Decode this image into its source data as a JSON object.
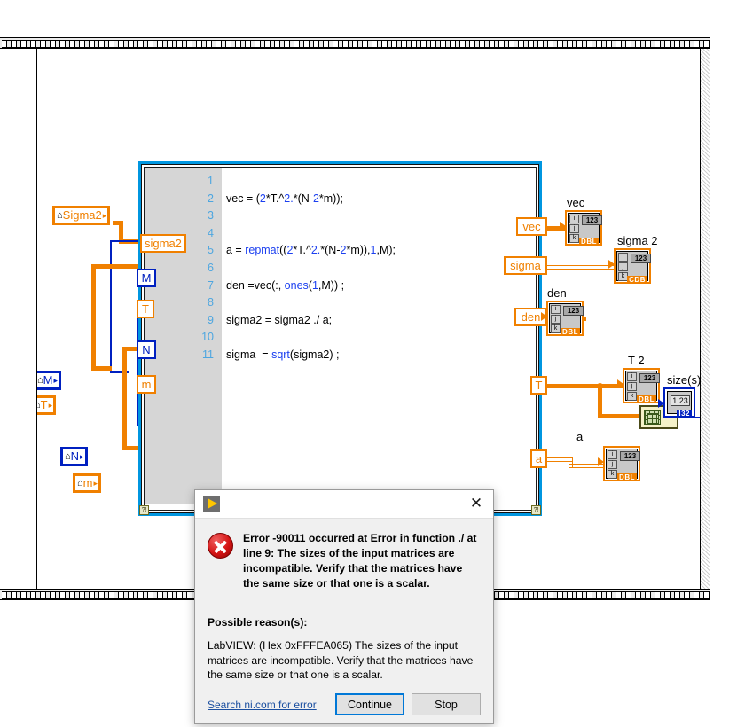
{
  "window": {
    "type": "labview-block-diagram"
  },
  "mathscript": {
    "line_numbers": [
      "1",
      "2",
      "3",
      "4",
      "5",
      "6",
      "7",
      "8",
      "9",
      "10",
      "11"
    ],
    "code_lines": [
      "",
      "vec = (2*T.^2.*(N-2*m));",
      "",
      "",
      "a = repmat((2*T.^2.*(N-2*m)),1,M);",
      "",
      "den =vec(:, ones(1,M)) ;",
      "",
      "sigma2 = sigma2 ./ a;",
      "",
      "sigma  = sqrt(sigma2) ;"
    ],
    "input_terminals": [
      {
        "label": "sigma2",
        "color": "#f08000"
      },
      {
        "label": "M",
        "color": "#0020c0"
      },
      {
        "label": "T",
        "color": "#f08000"
      },
      {
        "label": "N",
        "color": "#0020c0"
      },
      {
        "label": "m",
        "color": "#f08000"
      }
    ],
    "output_terminals": [
      {
        "label": "vec",
        "color": "#f08000"
      },
      {
        "label": "sigma",
        "color": "#f08000"
      },
      {
        "label": "den",
        "color": "#f08000"
      },
      {
        "label": "T",
        "color": "#f08000"
      },
      {
        "label": "a",
        "color": "#f08000"
      }
    ],
    "error_terminal_glyph": "?!"
  },
  "controls": [
    {
      "name": "Sigma2",
      "glyph": "⌂",
      "arrow": "▸",
      "color": "#f08000"
    },
    {
      "name": "M",
      "glyph": "⌂",
      "arrow": "▸",
      "color": "#0020c0"
    },
    {
      "name": "T",
      "glyph": "⌂",
      "arrow": "▸",
      "color": "#f08000"
    },
    {
      "name": "N",
      "glyph": "⌂",
      "arrow": "▸",
      "color": "#0020c0"
    },
    {
      "name": "m",
      "glyph": "⌂",
      "arrow": "▸",
      "color": "#f08000"
    }
  ],
  "indicators": [
    {
      "label": "vec",
      "type_tag": "DBL",
      "numeric": "123",
      "dims": [
        "i",
        "j",
        "k"
      ],
      "color": "#f08000"
    },
    {
      "label": "sigma 2",
      "type_tag": "CDB",
      "numeric": "123",
      "dims": [
        "i",
        "j",
        "k"
      ],
      "color": "#f08000"
    },
    {
      "label": "den",
      "type_tag": "DBL",
      "numeric": "123",
      "dims": [
        "i",
        "j",
        "k"
      ],
      "color": "#f08000"
    },
    {
      "label": "T 2",
      "type_tag": "DBL",
      "numeric": "123",
      "dims": [
        "i",
        "j",
        "k"
      ],
      "color": "#f08000"
    },
    {
      "label": "a",
      "type_tag": "DBL",
      "numeric": "123",
      "dims": [
        "i",
        "j",
        "k"
      ],
      "color": "#f08000"
    },
    {
      "label": "size(s)",
      "type_tag": "I32",
      "numeric": "1.23",
      "color": "#0020c0"
    }
  ],
  "functions": [
    {
      "name": "array-size",
      "label": ""
    }
  ],
  "dialog": {
    "title": "",
    "close_label": "✕",
    "error_message": "Error -90011 occurred at Error in function ./ at line 9:  The sizes of the input matrices are incompatible.  Verify that the matrices have the same size or that one is a scalar.",
    "reason_heading": "Possible reason(s):",
    "reason_body": "LabVIEW:  (Hex 0xFFFEA065) The sizes of the input matrices are incompatible.  Verify that the matrices have the same size or that one is a scalar.",
    "link_label": "Search ni.com for error",
    "continue_label": "Continue",
    "stop_label": "Stop"
  }
}
